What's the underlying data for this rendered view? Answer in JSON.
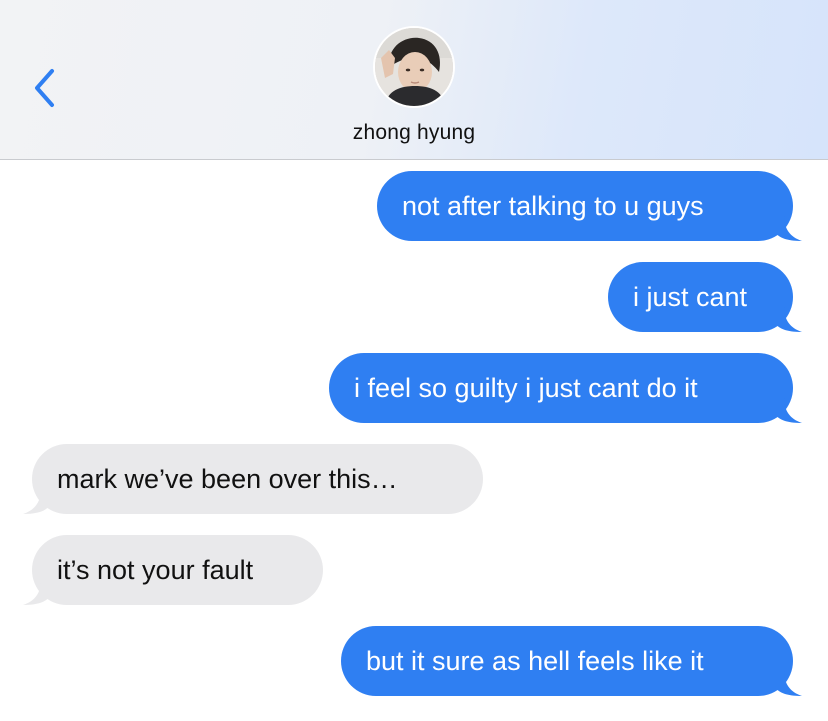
{
  "header": {
    "contact_name": "zhong hyung",
    "back_icon": "chevron-left-icon"
  },
  "colors": {
    "sent_bubble": "#2f7ff2",
    "received_bubble": "#e9e9eb",
    "accent": "#2f7ff2"
  },
  "messages": [
    {
      "direction": "sent",
      "text": "not after talking to u guys"
    },
    {
      "direction": "sent",
      "text": "i just cant"
    },
    {
      "direction": "sent",
      "text": "i feel so guilty i just cant do it"
    },
    {
      "direction": "received",
      "text": "mark we’ve been over this…"
    },
    {
      "direction": "received",
      "text": "it’s not your fault"
    },
    {
      "direction": "sent",
      "text": "but it sure as hell feels like it"
    }
  ]
}
